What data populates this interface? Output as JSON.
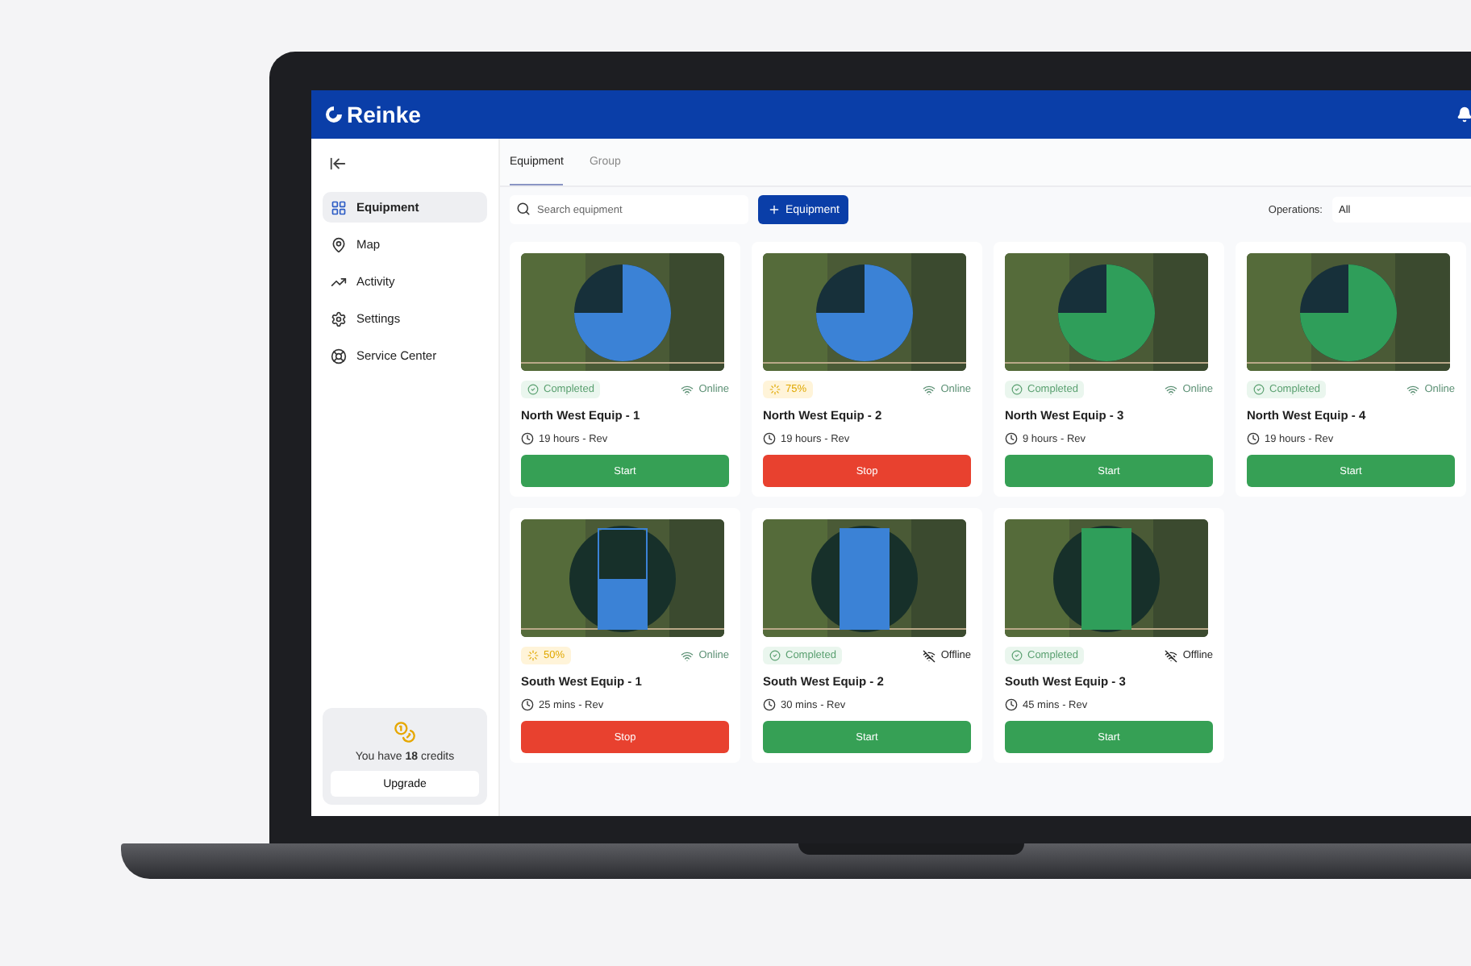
{
  "header": {
    "brand": "Reinke"
  },
  "sidebar": {
    "items": [
      {
        "label": "Equipment",
        "selected": true
      },
      {
        "label": "Map",
        "selected": false
      },
      {
        "label": "Activity",
        "selected": false
      },
      {
        "label": "Settings",
        "selected": false
      },
      {
        "label": "Service Center",
        "selected": false
      }
    ],
    "credits": {
      "text": "You have **18** credits",
      "button": "Upgrade"
    }
  },
  "tabs": [
    {
      "label": "Equipment",
      "selected": true
    },
    {
      "label": "Group",
      "selected": false
    }
  ],
  "toolbar": {
    "search_placeholder": "Search equipment",
    "add_button": "Equipment",
    "operations_label": "Operations:",
    "operations_value": "All"
  },
  "cards": [
    {
      "name": "North West Equip - 1",
      "kind": "circle",
      "color": "#3b82d6",
      "status": {
        "kind": "completed",
        "text": "Completed"
      },
      "online": true,
      "connection": "Online",
      "time": "19 hours - Rev",
      "button": {
        "kind": "start",
        "label": "Start"
      }
    },
    {
      "name": "North West Equip - 2",
      "kind": "circle",
      "color": "#3b82d6",
      "status": {
        "kind": "progress",
        "text": "75%"
      },
      "online": true,
      "connection": "Online",
      "time": "19 hours - Rev",
      "button": {
        "kind": "stop",
        "label": "Stop"
      }
    },
    {
      "name": "North West Equip - 3",
      "kind": "circle",
      "color": "#2f9e5a",
      "status": {
        "kind": "completed",
        "text": "Completed"
      },
      "online": true,
      "connection": "Online",
      "time": "9 hours - Rev",
      "button": {
        "kind": "start",
        "label": "Start"
      }
    },
    {
      "name": "North West Equip - 4",
      "kind": "circle",
      "color": "#2f9e5a",
      "status": {
        "kind": "completed",
        "text": "Completed"
      },
      "online": true,
      "connection": "Online",
      "time": "19 hours - Rev",
      "button": {
        "kind": "start",
        "label": "Start"
      }
    },
    {
      "name": "South West Equip - 1",
      "kind": "rect",
      "color": "#3b82d6",
      "status": {
        "kind": "progress",
        "text": "50%"
      },
      "online": true,
      "connection": "Online",
      "time": "25 mins - Rev",
      "button": {
        "kind": "stop",
        "label": "Stop"
      }
    },
    {
      "name": "South West Equip - 2",
      "kind": "rect",
      "color": "#3b82d6",
      "status": {
        "kind": "completed",
        "text": "Completed"
      },
      "online": false,
      "connection": "Offline",
      "time": "30 mins - Rev",
      "button": {
        "kind": "start",
        "label": "Start"
      }
    },
    {
      "name": "South West Equip - 3",
      "kind": "rect",
      "color": "#2f9e5a",
      "status": {
        "kind": "completed",
        "text": "Completed"
      },
      "online": false,
      "connection": "Offline",
      "time": "45 mins - Rev",
      "button": {
        "kind": "start",
        "label": "Start"
      }
    }
  ]
}
